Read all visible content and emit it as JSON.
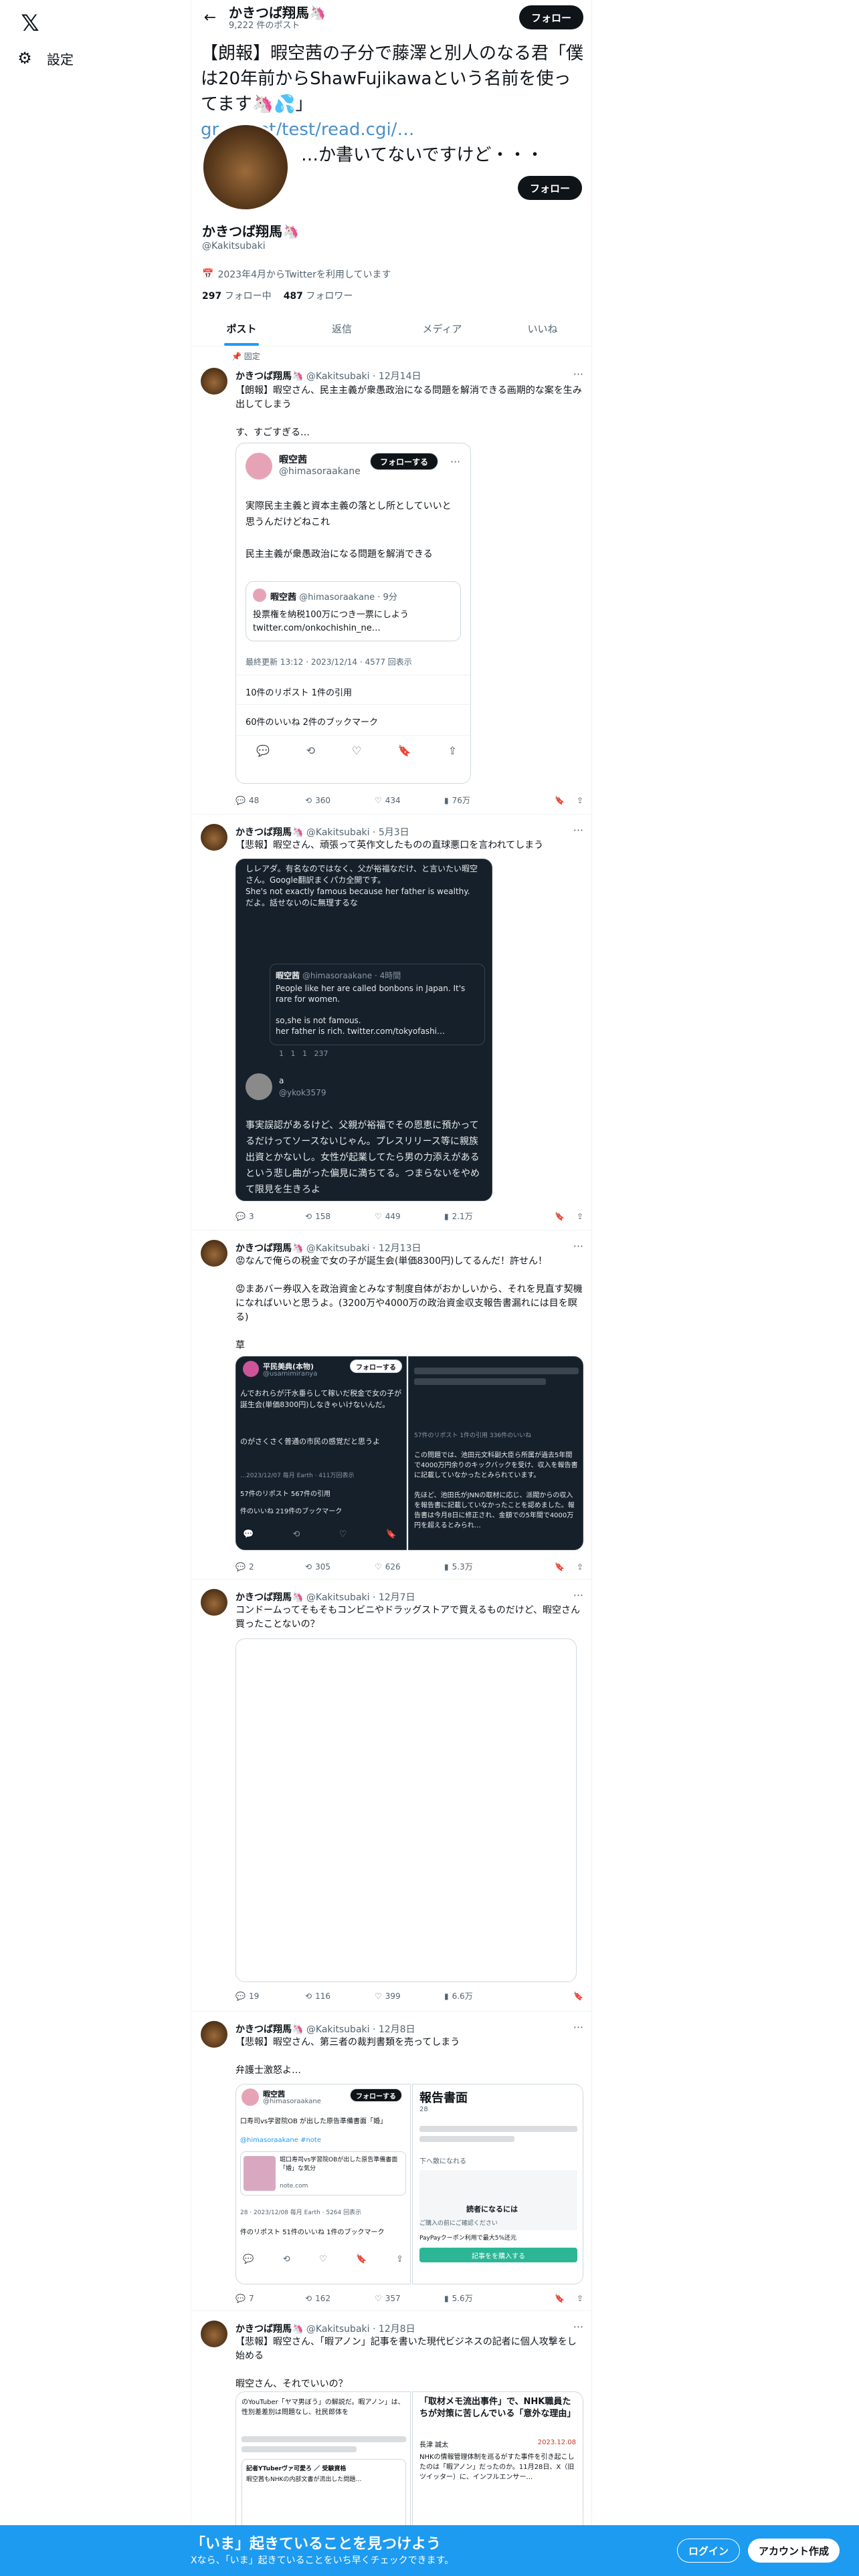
{
  "nav": {
    "logo": "𝕏",
    "settings": "設定"
  },
  "topbar": {
    "name": "かきつば翔馬🦄",
    "posts_count": "9,222 件のポスト",
    "follow": "フォロー"
  },
  "banner": {
    "text": "【朗報】暇空茜の子分で藤澤と別人のなる君「僕は20年前からShawFujikawaという名前を使ってます🦄💦」",
    "link": "gr… .net/test/read.cgi/…",
    "tail": "…か書いてないですけど・・・"
  },
  "profile": {
    "follow": "フォロー",
    "name": "かきつば翔馬🦄",
    "handle": "@Kakitsubaki",
    "joined": "2023年4月からTwitterを利用しています",
    "following_count": "297",
    "following_label": "フォロー中",
    "followers_count": "487",
    "followers_label": "フォロワー"
  },
  "tabs": [
    "ポスト",
    "返信",
    "メディア",
    "いいね"
  ],
  "tweets": [
    {
      "pinned": "固定",
      "name": "かきつば翔馬🦄",
      "handle": "@Kakitsubaki · 12月14日",
      "text": "【朗報】暇空さん、民主主義が衆愚政治になる問題を解消できる画期的な案を生み出してしまう\n\nす、すごすぎる…",
      "quote": {
        "name": "暇空茜",
        "handle": "@himasoraakane",
        "follow": "フォローする",
        "text": "実際民主主義と資本主義の落とし所としていいと思うんだけどねこれ\n\n民主主義が衆愚政治になる問題を解消できる",
        "inner_name": "暇空茜",
        "inner_handle": "@himasoraakane · 9分",
        "inner_text": "投票権を納税100万につき一票にしよう twitter.com/onkochishin_ne…",
        "meta": "最終更新 13:12 · 2023/12/14 · 4577 回表示",
        "reposts": "10件のリポスト 1件の引用",
        "likes": "60件のいいね 2件のブックマーク"
      },
      "replies": "48",
      "retweets": "360",
      "likes": "434",
      "views": "76万"
    },
    {
      "name": "かきつば翔馬🦄",
      "handle": "@Kakitsubaki · 5月3日",
      "text": "【悲報】暇空さん、頑張って英作文したものの直球悪口を言われてしまう",
      "shot": {
        "top": "しレアダ。有名なのではなく、父が裕福なだけ、と言いたい暇空さん。Google翻訳まくパカ全開です。\nShe's not exactly famous because her father is wealthy.\nだよ。話せないのに無理するな",
        "q_name": "暇空茜",
        "q_handle": "@himasoraakane · 4時間",
        "q_text": "People like her are called bonbons in Japan. It's rare for women.\n\nso,she is not famous.\nher father is rich. twitter.com/tokyofashi…",
        "q_stats": "1   1   1   237",
        "r_name": "a",
        "r_handle": "@ykok3579",
        "bottom": "事実誤認があるけど、父親が裕福でその恩恵に預かってるだけってソースないじゃん。プレスリリース等に親族出資とかないし。女性が起業してたら男の力添えがあるという悲し曲がった偏見に満ちてる。つまらないをやめて限見を生きろよ"
      },
      "replies": "3",
      "retweets": "158",
      "likes": "449",
      "views": "2.1万"
    },
    {
      "name": "かきつば翔馬🦄",
      "handle": "@Kakitsubaki · 12月13日",
      "text": "😡なんで俺らの税金で女の子が誕生会(単価8300円)してるんだ！許せん！\n\n😡まあバー券収入を政治資金とみなす制度自体がおかしいから、それを見直す契機になればいいと思うよ。(3200万や4000万の政治資金収支報告書漏れには目を瞑る)\n\n草",
      "img_left": {
        "name": "平民美典(本物)",
        "handle": "@usamimiranya",
        "follow": "フォローする",
        "text": "んでおれらが汗水垂らして稼いだ税金で女の子が誕生会(単価8300円)しなきゃいけないんだ。",
        "text2": "のがさくさく普通の市民の感覚だと思うよ",
        "meta": "…2023/12/07 毎月 Earth · 411万回表示",
        "stats": "57件のリポスト 567件の引用",
        "stats2": "件のいいね 219件のブックマーク"
      },
      "img_right": {
        "text": "この問題では、池田元文科副大臣ら所属が過去5年間で4000万円余りのキックバックを受け、収入を報告書に記載していなかったとみられています。\n\n先ほど、池田氏がJNNの取材に応じ、派閥からの収入を報告書に記載していなかったことを認めました。報告書は今月8日に修正され、金額での5年間で4000万円を超えるとみられ…",
        "meta": "57件のリポスト 1件の引用 336件のいいね"
      },
      "replies": "2",
      "retweets": "305",
      "likes": "626",
      "views": "5.3万"
    },
    {
      "name": "かきつば翔馬🦄",
      "handle": "@Kakitsubaki · 12月7日",
      "text": "コンドームってそもそもコンビニやドラッグストアで買えるものだけど、暇空さん買ったことないの？",
      "replies": "19",
      "retweets": "116",
      "likes": "399",
      "views": "6.6万"
    },
    {
      "name": "かきつば翔馬🦄",
      "handle": "@Kakitsubaki · 12月8日",
      "text": "【悲報】暇空さん、第三者の裁判書類を売ってしまう\n\n弁護士激怒よ…",
      "img_left": {
        "name": "暇空茜",
        "handle": "@himasoraakane",
        "follow": "フォローする",
        "text": "口寿司vs学習院OB が出した原告準備書面「婚」",
        "link": "@himasoraakane #note",
        "card": "堀口寿司vs学習院OBが出した原告準備書面「婚」な気分",
        "card_src": "note.com",
        "meta": "28 · 2023/12/08 毎月 Earth · 5264 回表示",
        "stats": "件のリポスト 51件のいいね 1件のブックマーク"
      },
      "img_right": {
        "title": "報告書面",
        "num": "28",
        "notice": "ご購入の前にご確認ください",
        "notice2": "下へ散になれる",
        "cta": "読者になるには",
        "pay": "PayPayクーポン利用で最大5%还元",
        "btn": "記事をを購入する"
      },
      "replies": "7",
      "retweets": "162",
      "likes": "357",
      "views": "5.6万"
    },
    {
      "name": "かきつば翔馬🦄",
      "handle": "@Kakitsubaki · 12月8日",
      "text": "【悲報】暇空さん、「暇アノン」記事を書いた現代ビジネスの記者に個人攻撃をし始める\n\n暇空さん、それでいいの？",
      "img_right": {
        "title": "「取材メモ流出事件」で、NHK職員たちが対策に苦しんでいる「意外な理由」",
        "author": "長津 誠太",
        "date": "2023.12.08",
        "body": "NHKの情報管理体制を巡るがすた事件を引き起こしたのは「暇アノン」だったのか。11月28日、X（旧ツイッター）に、インフルエンサー…"
      },
      "img_left": {
        "text": "のYouTuber「ヤマ男ぼう」の解説だ。暇アノン」は、性別差差別は問題なし、社民郎体を",
        "author": "記者YTuberヴァ可愛ろ ／ 受験資格",
        "text2": "暇空茜もNHKの内部文書が流出した問題…"
      }
    }
  ],
  "bottom": {
    "title": "「いま」起きていることを見つけよう",
    "sub": "Xなら、「いま」起きていることをいち早くチェックできます。",
    "login": "ログイン",
    "signup": "アカウント作成"
  }
}
